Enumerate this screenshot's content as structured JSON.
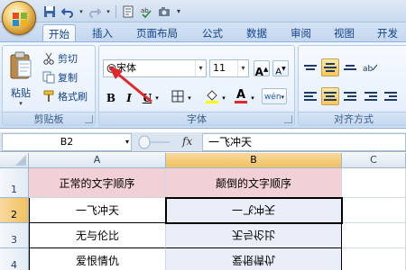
{
  "tabs": [
    {
      "label": "开始",
      "active": true
    },
    {
      "label": "插入"
    },
    {
      "label": "页面布局"
    },
    {
      "label": "公式"
    },
    {
      "label": "数据"
    },
    {
      "label": "审阅"
    },
    {
      "label": "视图"
    },
    {
      "label": "开发工"
    }
  ],
  "clipboard": {
    "paste": "粘贴",
    "cut": "剪切",
    "copy": "复制",
    "format_painter": "格式刷",
    "group_label": "剪贴板"
  },
  "font": {
    "name": "@宋体",
    "size": "11",
    "bold": "B",
    "italic": "I",
    "underline": "U",
    "text_color_glyph": "A",
    "pinyin_glyph": "wén",
    "group_label": "字体"
  },
  "alignment": {
    "group_label": "对齐方式"
  },
  "formula_bar": {
    "name_box": "B2",
    "fx": "fx",
    "value": "一飞冲天"
  },
  "sheet": {
    "columns": [
      "A",
      "B",
      "C"
    ],
    "rows": [
      "1",
      "2",
      "3",
      "4"
    ],
    "cells": {
      "A1": "正常的文字顺序",
      "B1": "颠倒的文字顺序",
      "A2": "一飞冲天",
      "B2": "一飞冲天",
      "A3": "无与伦比",
      "B3": "无与伦比",
      "A4": "爱恨情仇",
      "B4": "爱恨情仇"
    }
  },
  "colors": {
    "header_fill": "#f2d1d6",
    "accent_arrow": "#e0282a",
    "selected_header": "#f1c15f"
  }
}
